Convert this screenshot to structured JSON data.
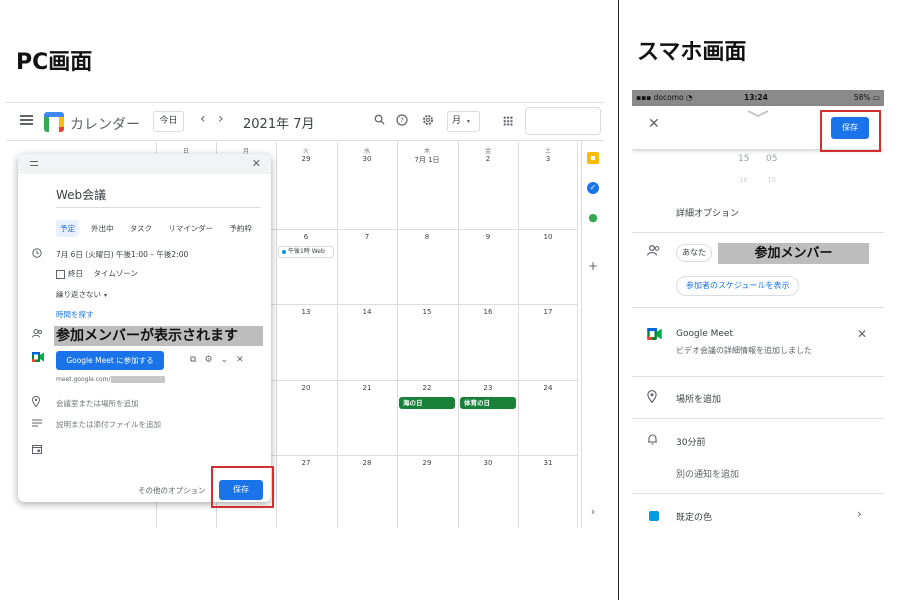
{
  "headings": {
    "pc": "PC画面",
    "smartphone": "スマホ画面"
  },
  "pc": {
    "app_title": "カレンダー",
    "today_label": "今日",
    "month_label": "2021年 7月",
    "view_label": "月",
    "grid": {
      "weekdays": [
        "日",
        "月",
        "火",
        "水",
        "木",
        "金",
        "土"
      ],
      "weeks": [
        [
          "",
          "",
          "29",
          "30",
          "7月 1日",
          "2",
          "3"
        ],
        [
          "",
          "",
          "6",
          "7",
          "8",
          "9",
          "10"
        ],
        [
          "",
          "",
          "13",
          "14",
          "15",
          "16",
          "17"
        ],
        [
          "",
          "",
          "20",
          "21",
          "22",
          "23",
          "24"
        ],
        [
          "",
          "",
          "27",
          "28",
          "29",
          "30",
          "31"
        ]
      ],
      "events": {
        "tue6": "午後1時 Web",
        "holiday22": "海の日",
        "holiday23": "体育の日"
      }
    },
    "dialog": {
      "title": "Web会議",
      "tabs": [
        "予定",
        "外出中",
        "タスク",
        "リマインダー",
        "予約枠"
      ],
      "date_line": "7月 6日 (火曜日)   午後1:00  –  午後2:00",
      "all_day": "終日",
      "timezone": "タイムゾーン",
      "repeat": "繰り返さない",
      "find_time": "時間を探す",
      "members_banner": "参加メンバーが表示されます",
      "meet_button": "Google Meet に参加する",
      "meet_url": "meet.google.com/",
      "location_placeholder": "会議室または場所を追加",
      "description_placeholder": "説明または添付ファイルを追加",
      "more_options": "その他のオプション",
      "save": "保存"
    }
  },
  "smartphone": {
    "status": {
      "carrier": "docomo",
      "time": "13:24",
      "battery": "58%"
    },
    "save": "保存",
    "picker": {
      "hour": "15",
      "minute": "05",
      "hour_next": "16",
      "minute_next": "10"
    },
    "detail_options": "詳細オプション",
    "you_chip": "あなた",
    "members_banner": "参加メンバー",
    "view_schedules": "参加者のスケジュールを表示",
    "meet_title": "Google Meet",
    "meet_sub": "ビデオ会議の詳細情報を追加しました",
    "add_location": "場所を追加",
    "reminder": "30分前",
    "add_notification": "別の通知を追加",
    "default_color": "既定の色"
  }
}
